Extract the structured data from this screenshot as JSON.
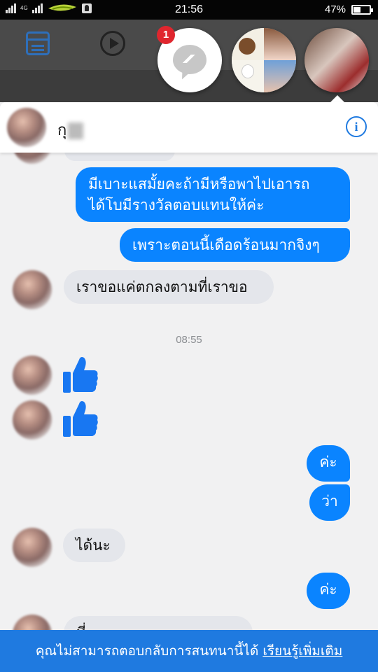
{
  "status_bar": {
    "network": "4G",
    "time": "21:56",
    "battery_percent": "47%",
    "battery_level": 0.47,
    "icons": [
      "signal-icon",
      "carrier-logo-icon",
      "app-notification-icon",
      "battery-icon"
    ]
  },
  "app_bar": {
    "icons": [
      "news-feed-icon",
      "video-play-icon"
    ]
  },
  "chat_heads": {
    "messenger_badge": "1",
    "icons": [
      "messenger-icon"
    ]
  },
  "chat": {
    "title": "กุ",
    "messages": [
      {
        "side": "out",
        "text_lines": [
          "มีเบาะแสมั้ยคะถ้ามีหรือพาไปเอารถ",
          "ได้โบมีรางวัลตอบแทนให้ค่ะ"
        ]
      },
      {
        "side": "out",
        "text": "เพราะตอนนี้เดือดร้อนมากจิงๆ"
      },
      {
        "side": "in",
        "text": "เราขอแค่ตกลงตามที่เราขอ"
      },
      {
        "timestamp": "08:55"
      },
      {
        "side": "in",
        "type": "like"
      },
      {
        "side": "in",
        "type": "like"
      },
      {
        "side": "out",
        "text": "ค่ะ"
      },
      {
        "side": "out",
        "text": "ว่า"
      },
      {
        "side": "in",
        "text": "ได้นะ"
      },
      {
        "side": "out",
        "text": "ค่ะ"
      },
      {
        "side": "in",
        "text": "ที่..."
      }
    ]
  },
  "footer": {
    "notice": "คุณไม่สามารถตอบกลับการสนทนานี้ได้ ",
    "link": "เรียนรู้เพิ่มเติม"
  },
  "colors": {
    "accent": "#1f7ae0",
    "outgoing_bubble": "#0a84ff",
    "incoming_bubble": "#e4e6eb",
    "badge": "#e0262e"
  }
}
